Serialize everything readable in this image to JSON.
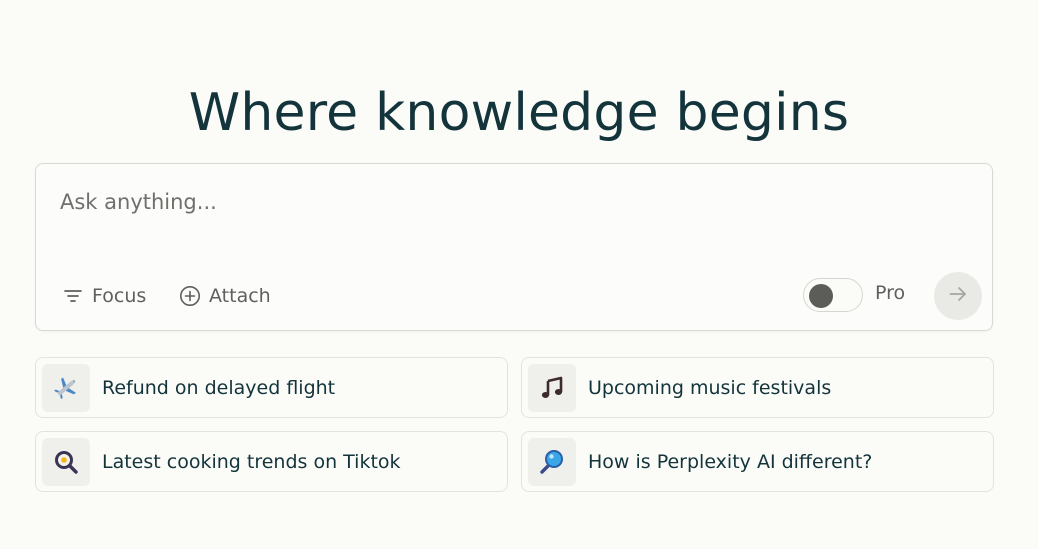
{
  "headline": "Where knowledge begins",
  "search": {
    "placeholder": "Ask anything...",
    "value": ""
  },
  "toolbar": {
    "focus_label": "Focus",
    "attach_label": "Attach",
    "pro_label": "Pro",
    "pro_enabled": false
  },
  "suggestions": [
    {
      "label": "Refund on delayed flight",
      "icon": "airplane-icon"
    },
    {
      "label": "Upcoming music festivals",
      "icon": "music-note-icon"
    },
    {
      "label": "Latest cooking trends on Tiktok",
      "icon": "frying-pan-egg-icon"
    },
    {
      "label": "How is Perplexity AI different?",
      "icon": "magnifying-glass-icon"
    }
  ],
  "colors": {
    "background": "#fbfbf8",
    "text_primary": "#13343b",
    "text_muted": "#5f5f5b"
  }
}
